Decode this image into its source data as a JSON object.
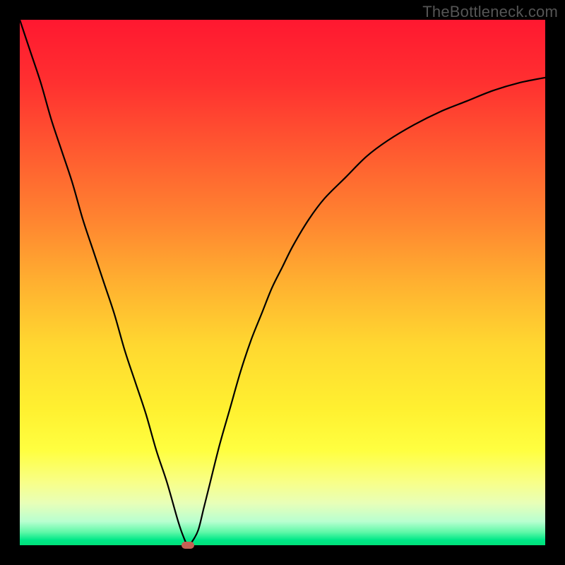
{
  "watermark": "TheBottleneck.com",
  "marker_color": "#C66054",
  "chart_data": {
    "type": "line",
    "title": "",
    "xlabel": "",
    "ylabel": "",
    "xlim": [
      0,
      100
    ],
    "ylim": [
      0,
      100
    ],
    "series": [
      {
        "name": "bottleneck-curve",
        "x": [
          0,
          2,
          4,
          6,
          8,
          10,
          12,
          14,
          16,
          18,
          20,
          22,
          24,
          26,
          28,
          30,
          31,
          32,
          33,
          34,
          35,
          36,
          38,
          40,
          42,
          44,
          46,
          48,
          50,
          52,
          55,
          58,
          62,
          66,
          70,
          75,
          80,
          85,
          90,
          95,
          100
        ],
        "values": [
          100,
          94,
          88,
          81,
          75,
          69,
          62,
          56,
          50,
          44,
          37,
          31,
          25,
          18,
          12,
          5,
          2,
          0,
          1,
          3,
          7,
          11,
          19,
          26,
          33,
          39,
          44,
          49,
          53,
          57,
          62,
          66,
          70,
          74,
          77,
          80,
          82.5,
          84.5,
          86.5,
          88,
          89
        ]
      }
    ],
    "annotations": [
      {
        "name": "optimal-point",
        "x": 32,
        "y": 0
      }
    ],
    "background_gradient_stops": [
      {
        "offset": 0.0,
        "color": "#FF1830"
      },
      {
        "offset": 0.12,
        "color": "#FF3030"
      },
      {
        "offset": 0.25,
        "color": "#FF5A30"
      },
      {
        "offset": 0.38,
        "color": "#FF8430"
      },
      {
        "offset": 0.5,
        "color": "#FFB030"
      },
      {
        "offset": 0.62,
        "color": "#FFD830"
      },
      {
        "offset": 0.74,
        "color": "#FFF030"
      },
      {
        "offset": 0.82,
        "color": "#FFFF40"
      },
      {
        "offset": 0.88,
        "color": "#F8FF88"
      },
      {
        "offset": 0.92,
        "color": "#E8FFB8"
      },
      {
        "offset": 0.955,
        "color": "#B8FFD0"
      },
      {
        "offset": 0.975,
        "color": "#60F8A8"
      },
      {
        "offset": 0.99,
        "color": "#00E888"
      },
      {
        "offset": 1.0,
        "color": "#00E078"
      }
    ]
  }
}
